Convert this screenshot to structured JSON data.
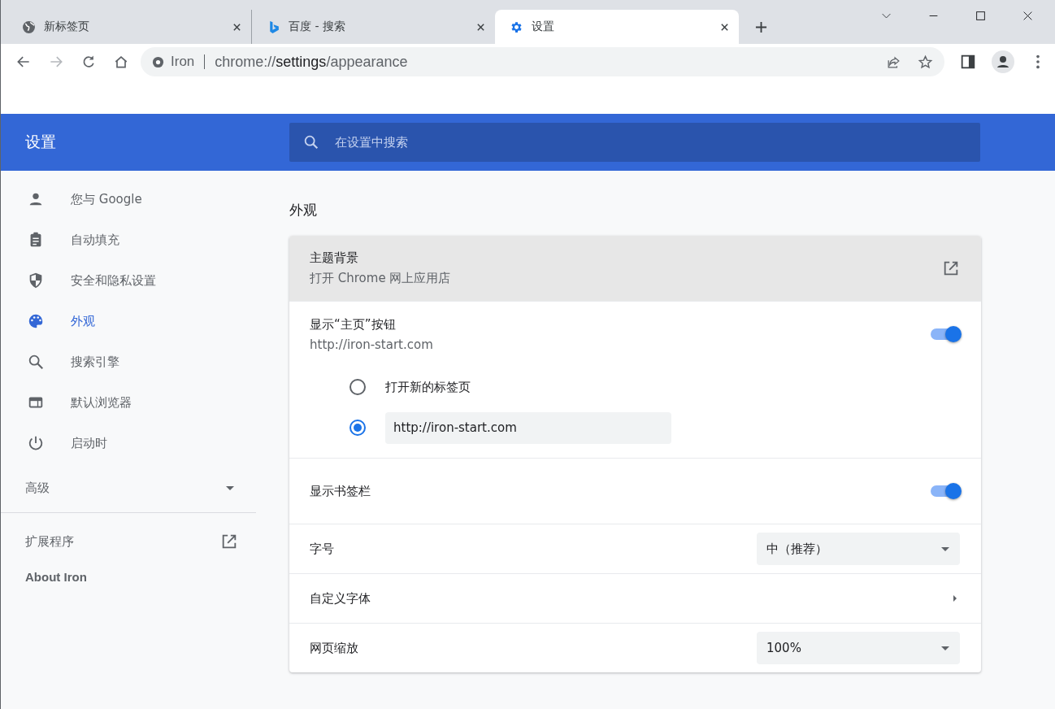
{
  "tabs": [
    {
      "title": "新标签页",
      "kind": "globe",
      "selected": false
    },
    {
      "title": "百度 - 搜索",
      "kind": "bing",
      "selected": false
    },
    {
      "title": "设置",
      "kind": "gear",
      "selected": true
    }
  ],
  "nav_buttons": [
    {
      "kind": "back",
      "disabled": false
    },
    {
      "kind": "forward",
      "disabled": true
    },
    {
      "kind": "reload",
      "disabled": false
    },
    {
      "kind": "home",
      "disabled": false
    }
  ],
  "address_bar": {
    "site": "Iron",
    "url_parts": [
      {
        "text": "chrome://",
        "emphasis": false
      },
      {
        "text": "settings",
        "emphasis": true
      },
      {
        "text": "/appearance",
        "emphasis": false
      }
    ]
  },
  "header": {
    "title": "设置",
    "search_placeholder": "在设置中搜索"
  },
  "sidebar": {
    "items": [
      {
        "label": "您与 Google",
        "kind": "person",
        "selected": false
      },
      {
        "label": "自动填充",
        "kind": "clipboard",
        "selected": false
      },
      {
        "label": "安全和隐私设置",
        "kind": "shield",
        "selected": false
      },
      {
        "label": "外观",
        "kind": "palette",
        "selected": true
      },
      {
        "label": "搜索引擎",
        "kind": "search",
        "selected": false
      },
      {
        "label": "默认浏览器",
        "kind": "browser",
        "selected": false
      },
      {
        "label": "启动时",
        "kind": "power",
        "selected": false
      }
    ],
    "advanced": {
      "label": "高级",
      "expanded": false
    },
    "extensions": "扩展程序",
    "about": "About Iron"
  },
  "section_title": "外观",
  "rows": [
    {
      "kind": "link",
      "title": "主题背景",
      "subtitle": "打开 Chrome 网上应用店",
      "highlighted": true
    },
    {
      "kind": "toggle",
      "title": "显示“主页”按钮",
      "subtitle": "http://iron-start.com",
      "on": true,
      "options": [
        {
          "kind": "text",
          "label": "打开新的标签页",
          "selected": false
        },
        {
          "kind": "input",
          "value": "http://iron-start.com",
          "selected": true
        }
      ]
    },
    {
      "kind": "toggle",
      "title": "显示书签栏",
      "on": true
    },
    {
      "kind": "select",
      "title": "字号",
      "value": "中（推荐）"
    },
    {
      "kind": "submenu",
      "title": "自定义字体"
    },
    {
      "kind": "select",
      "title": "网页缩放",
      "value": "100%"
    }
  ]
}
